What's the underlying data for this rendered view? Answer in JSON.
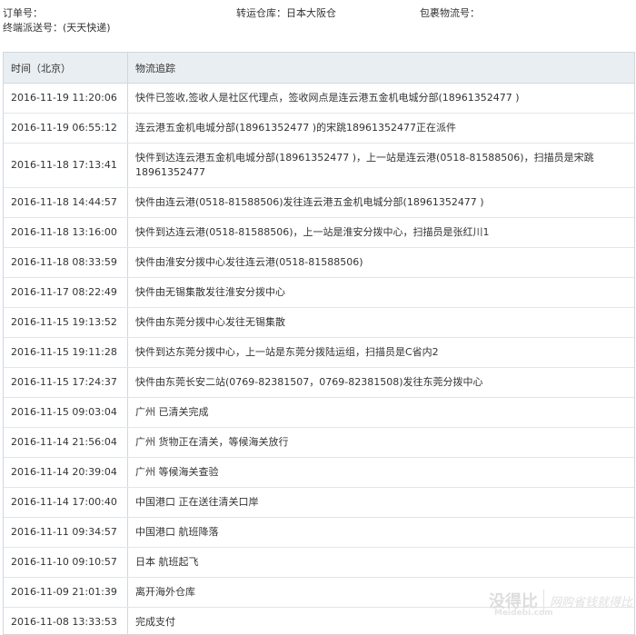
{
  "info": {
    "order_label": "订单号：",
    "warehouse_label": "转运仓库：",
    "warehouse_value": "日本大阪仓",
    "package_label": "包裹物流号：",
    "delivery_label": "终端派送号：",
    "delivery_suffix": "(天天快递)"
  },
  "table": {
    "headers": [
      "时间（北京）",
      "物流追踪"
    ],
    "rows": [
      {
        "time": "2016-11-19 11:20:06",
        "event": "快件已签收,签收人是社区代理点，签收网点是连云港五金机电城分部(18961352477 )"
      },
      {
        "time": "2016-11-19 06:55:12",
        "event": "连云港五金机电城分部(18961352477 )的宋跳18961352477正在派件"
      },
      {
        "time": "2016-11-18 17:13:41",
        "event": "快件到达连云港五金机电城分部(18961352477 )，上一站是连云港(0518-81588506)，扫描员是宋跳18961352477"
      },
      {
        "time": "2016-11-18 14:44:57",
        "event": "快件由连云港(0518-81588506)发往连云港五金机电城分部(18961352477 )"
      },
      {
        "time": "2016-11-18 13:16:00",
        "event": "快件到达连云港(0518-81588506)，上一站是淮安分拨中心，扫描员是张红川1"
      },
      {
        "time": "2016-11-18 08:33:59",
        "event": "快件由淮安分拨中心发往连云港(0518-81588506)"
      },
      {
        "time": "2016-11-17 08:22:49",
        "event": "快件由无锡集散发往淮安分拨中心"
      },
      {
        "time": "2016-11-15 19:13:52",
        "event": "快件由东莞分拨中心发往无锡集散"
      },
      {
        "time": "2016-11-15 19:11:28",
        "event": "快件到达东莞分拨中心，上一站是东莞分拨陆运组，扫描员是C省内2"
      },
      {
        "time": "2016-11-15 17:24:37",
        "event": "快件由东莞长安二站(0769-82381507，0769-82381508)发往东莞分拨中心"
      },
      {
        "time": "2016-11-15 09:03:04",
        "event": "广州 已清关完成"
      },
      {
        "time": "2016-11-14 21:56:04",
        "event": "广州 货物正在清关，等候海关放行"
      },
      {
        "time": "2016-11-14 20:39:04",
        "event": "广州 等候海关查验"
      },
      {
        "time": "2016-11-14 17:00:40",
        "event": "中国港口 正在送往清关口岸"
      },
      {
        "time": "2016-11-11 09:34:57",
        "event": "中国港口 航班降落"
      },
      {
        "time": "2016-11-10 09:10:57",
        "event": "日本 航班起飞"
      },
      {
        "time": "2016-11-09 21:01:39",
        "event": "离开海外仓库"
      },
      {
        "time": "2016-11-08 13:33:53",
        "event": "完成支付"
      }
    ]
  },
  "watermark": {
    "brand": "没得比",
    "sub": "Meidebi.com",
    "slogan": "网购省钱就得比"
  }
}
